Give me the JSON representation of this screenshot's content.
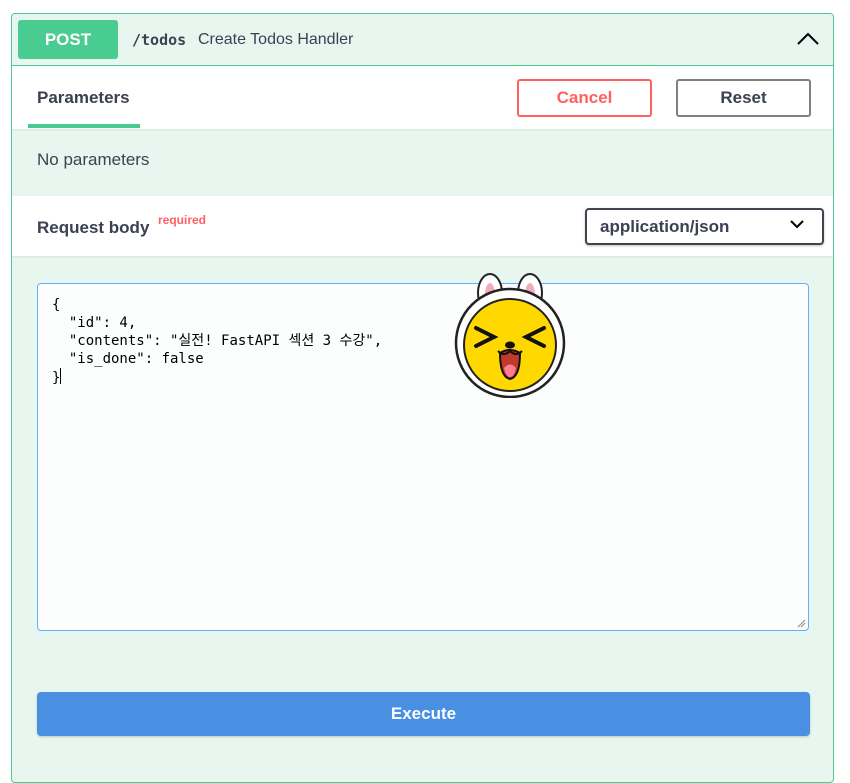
{
  "operation": {
    "method": "POST",
    "path": "/todos",
    "summary": "Create Todos Handler"
  },
  "parameters": {
    "tab_label": "Parameters",
    "cancel_label": "Cancel",
    "reset_label": "Reset",
    "empty_text": "No parameters"
  },
  "request_body": {
    "label": "Request body",
    "required_label": "required",
    "content_type": "application/json",
    "editor_lines": [
      "{",
      "  \"id\": 4,",
      "  \"contents\": \"실전! FastAPI 섹션 3 수강\",",
      "  \"is_done\": false",
      "}"
    ]
  },
  "execute_label": "Execute",
  "colors": {
    "post_green": "#49cc90",
    "cancel_red": "#ff6060",
    "execute_blue": "#4990e2",
    "editor_border": "#61affe"
  },
  "icons": [
    "chevron-up-icon",
    "chevron-down-icon",
    "resize-grip-icon",
    "bunny-sticker"
  ]
}
